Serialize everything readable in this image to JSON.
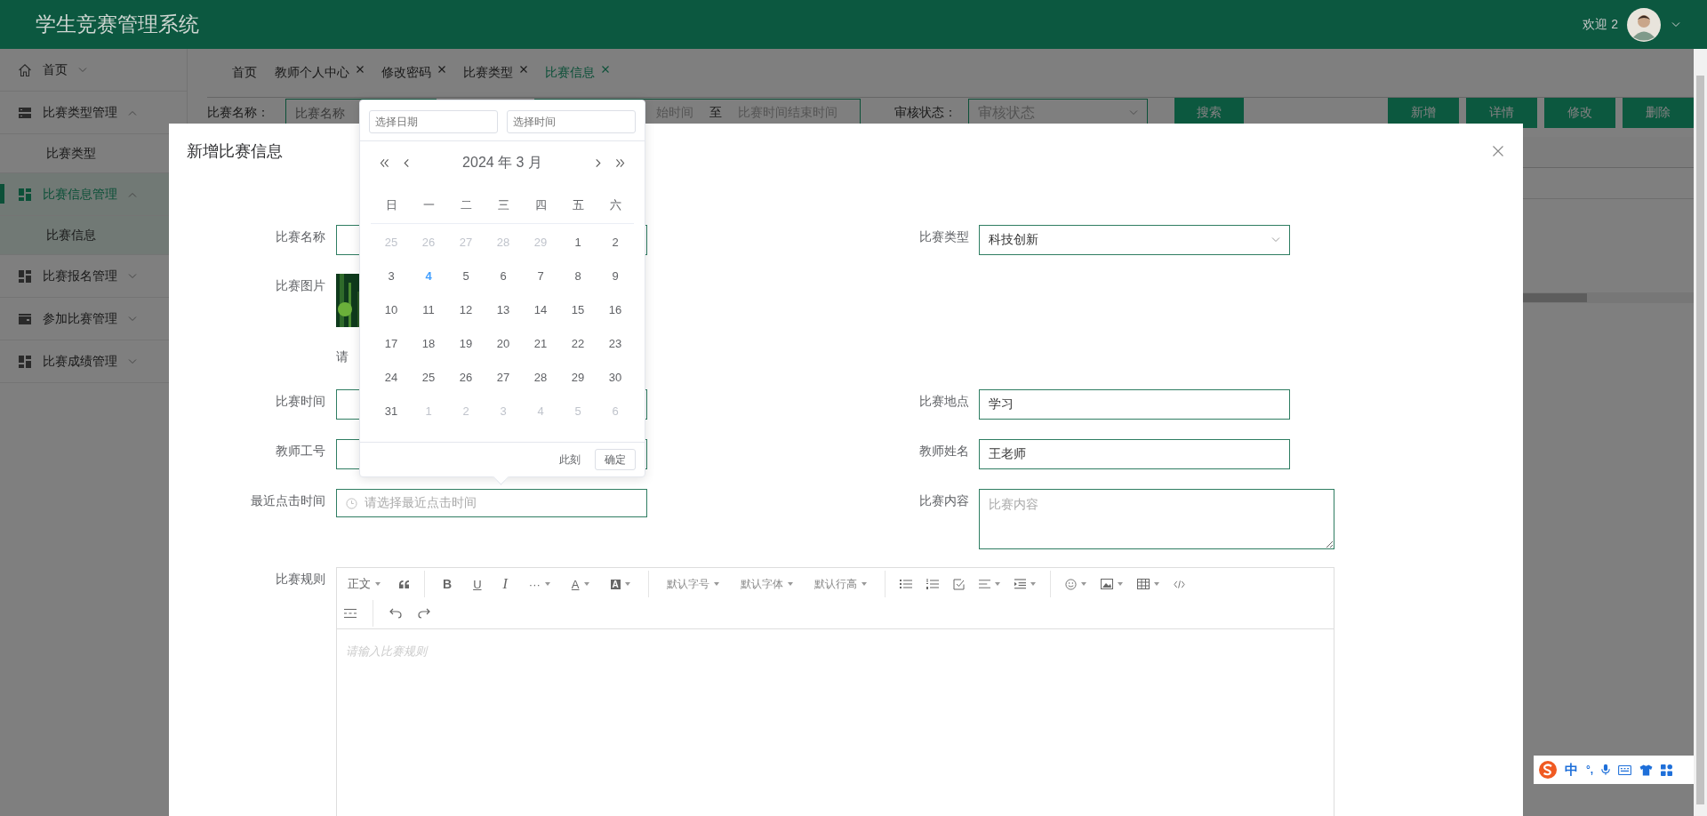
{
  "header": {
    "title": "学生竞赛管理系统",
    "welcome": "欢迎 2"
  },
  "sidebar": {
    "items": [
      {
        "kind": "home",
        "label": "首页",
        "expanded": false,
        "selected": false
      },
      {
        "kind": "list",
        "label": "比赛类型管理",
        "expanded": true,
        "selected": false,
        "children": [
          {
            "label": "比赛类型",
            "selected": false
          }
        ]
      },
      {
        "kind": "grid",
        "label": "比赛信息管理",
        "expanded": true,
        "selected": true,
        "children": [
          {
            "label": "比赛信息",
            "selected": true
          }
        ]
      },
      {
        "kind": "grid",
        "label": "比赛报名管理",
        "expanded": false,
        "selected": false
      },
      {
        "kind": "wallet",
        "label": "参加比赛管理",
        "expanded": false,
        "selected": false
      },
      {
        "kind": "grid",
        "label": "比赛成绩管理",
        "expanded": false,
        "selected": false
      }
    ]
  },
  "tabs": [
    {
      "label": "首页",
      "closable": false,
      "selected": false
    },
    {
      "label": "教师个人中心",
      "closable": true,
      "selected": false
    },
    {
      "label": "修改密码",
      "closable": true,
      "selected": false
    },
    {
      "label": "比赛类型",
      "closable": true,
      "selected": false
    },
    {
      "label": "比赛信息",
      "closable": true,
      "selected": true
    }
  ],
  "search": {
    "name_label": "比赛名称：",
    "name_placeholder": "比赛名称",
    "range_start_placeholder": "始时间",
    "range_separator": "至",
    "range_end_placeholder": "比赛时间结束时间",
    "status_label": "审核状态：",
    "status_placeholder": "审核状态",
    "search_button": "搜索"
  },
  "actions": [
    "新增",
    "详情",
    "修改",
    "删除"
  ],
  "dialog": {
    "title": "新增比赛信息",
    "rows": [
      {
        "left": {
          "kind": "input",
          "label": "比赛名称"
        },
        "right": {
          "kind": "select",
          "label": "比赛类型",
          "value": "科技创新"
        }
      },
      {
        "left": {
          "label": "比赛图片",
          "note": "请"
        }
      },
      {
        "left": {
          "kind": "input",
          "label": "比赛时间"
        },
        "right": {
          "kind": "input",
          "label": "比赛地点",
          "value": "学习"
        }
      },
      {
        "left": {
          "kind": "input",
          "label": "教师工号"
        },
        "right": {
          "kind": "input",
          "label": "教师姓名",
          "value": "王老师"
        }
      },
      {
        "left": {
          "kind": "datetime",
          "label": "最近点击时间",
          "placeholder": "请选择最近点击时间"
        },
        "right": {
          "kind": "textarea",
          "label": "比赛内容",
          "placeholder": "比赛内容"
        }
      }
    ],
    "editor": {
      "label": "比赛规则",
      "toolbar": {
        "paragraph": "正文",
        "bold": "B",
        "underline": "U",
        "italic": "I",
        "more": "···",
        "font_color": "A",
        "highlight": "A",
        "font_size": "默认字号",
        "font_family": "默认字体",
        "line_height": "默认行高"
      },
      "placeholder": "请输入比赛规则"
    }
  },
  "date_picker": {
    "date_placeholder": "选择日期",
    "time_placeholder": "选择时间",
    "title": "2024 年 3 月",
    "weekdays": [
      "日",
      "一",
      "二",
      "三",
      "四",
      "五",
      "六"
    ],
    "days": [
      {
        "label": "25",
        "in_month": false,
        "today": false
      },
      {
        "label": "26",
        "in_month": false,
        "today": false
      },
      {
        "label": "27",
        "in_month": false,
        "today": false
      },
      {
        "label": "28",
        "in_month": false,
        "today": false
      },
      {
        "label": "29",
        "in_month": false,
        "today": false
      },
      {
        "label": "1",
        "in_month": true,
        "today": false
      },
      {
        "label": "2",
        "in_month": true,
        "today": false
      },
      {
        "label": "3",
        "in_month": true,
        "today": false
      },
      {
        "label": "4",
        "in_month": true,
        "today": true
      },
      {
        "label": "5",
        "in_month": true,
        "today": false
      },
      {
        "label": "6",
        "in_month": true,
        "today": false
      },
      {
        "label": "7",
        "in_month": true,
        "today": false
      },
      {
        "label": "8",
        "in_month": true,
        "today": false
      },
      {
        "label": "9",
        "in_month": true,
        "today": false
      },
      {
        "label": "10",
        "in_month": true,
        "today": false
      },
      {
        "label": "11",
        "in_month": true,
        "today": false
      },
      {
        "label": "12",
        "in_month": true,
        "today": false
      },
      {
        "label": "13",
        "in_month": true,
        "today": false
      },
      {
        "label": "14",
        "in_month": true,
        "today": false
      },
      {
        "label": "15",
        "in_month": true,
        "today": false
      },
      {
        "label": "16",
        "in_month": true,
        "today": false
      },
      {
        "label": "17",
        "in_month": true,
        "today": false
      },
      {
        "label": "18",
        "in_month": true,
        "today": false
      },
      {
        "label": "19",
        "in_month": true,
        "today": false
      },
      {
        "label": "20",
        "in_month": true,
        "today": false
      },
      {
        "label": "21",
        "in_month": true,
        "today": false
      },
      {
        "label": "22",
        "in_month": true,
        "today": false
      },
      {
        "label": "23",
        "in_month": true,
        "today": false
      },
      {
        "label": "24",
        "in_month": true,
        "today": false
      },
      {
        "label": "25",
        "in_month": true,
        "today": false
      },
      {
        "label": "26",
        "in_month": true,
        "today": false
      },
      {
        "label": "27",
        "in_month": true,
        "today": false
      },
      {
        "label": "28",
        "in_month": true,
        "today": false
      },
      {
        "label": "29",
        "in_month": true,
        "today": false
      },
      {
        "label": "30",
        "in_month": true,
        "today": false
      },
      {
        "label": "31",
        "in_month": true,
        "today": false
      },
      {
        "label": "1",
        "in_month": false,
        "today": false
      },
      {
        "label": "2",
        "in_month": false,
        "today": false
      },
      {
        "label": "3",
        "in_month": false,
        "today": false
      },
      {
        "label": "4",
        "in_month": false,
        "today": false
      },
      {
        "label": "5",
        "in_month": false,
        "today": false
      },
      {
        "label": "6",
        "in_month": false,
        "today": false
      }
    ],
    "now_button": "此刻",
    "confirm_button": "确定"
  },
  "ime": {
    "mode": "中",
    "punctuation": "°,"
  }
}
